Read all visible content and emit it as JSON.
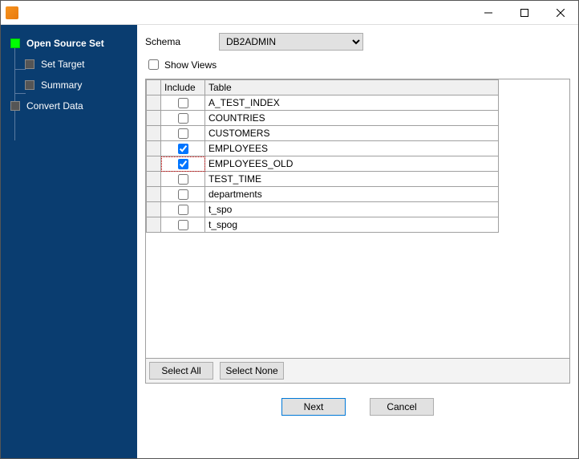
{
  "sidebar": {
    "items": [
      {
        "label": "Open Source Set",
        "active": true
      },
      {
        "label": "Set Target"
      },
      {
        "label": "Summary"
      },
      {
        "label": "Convert Data"
      }
    ]
  },
  "schema": {
    "label": "Schema",
    "selected": "DB2ADMIN",
    "options": [
      "DB2ADMIN"
    ]
  },
  "show_views": {
    "label": "Show Views",
    "checked": false
  },
  "table": {
    "headers": {
      "include": "Include",
      "table": "Table"
    },
    "rows": [
      {
        "include": false,
        "name": "A_TEST_INDEX"
      },
      {
        "include": false,
        "name": "COUNTRIES"
      },
      {
        "include": false,
        "name": "CUSTOMERS"
      },
      {
        "include": true,
        "name": "EMPLOYEES"
      },
      {
        "include": true,
        "name": "EMPLOYEES_OLD",
        "focused": true
      },
      {
        "include": false,
        "name": "TEST_TIME"
      },
      {
        "include": false,
        "name": "departments"
      },
      {
        "include": false,
        "name": "t_spo"
      },
      {
        "include": false,
        "name": "t_spog"
      }
    ]
  },
  "buttons": {
    "select_all": "Select All",
    "select_none": "Select None",
    "next": "Next",
    "cancel": "Cancel"
  }
}
